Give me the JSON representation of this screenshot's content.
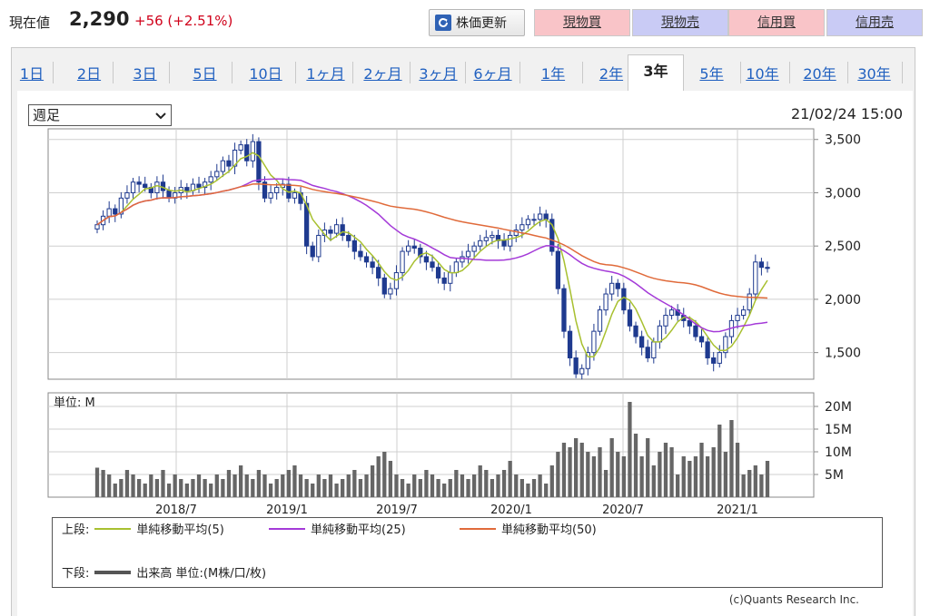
{
  "header": {
    "price_label": "現在値",
    "price_value": "2,290",
    "price_change": "+56 (+2.51%)",
    "refresh_label": "株価更新",
    "buttons": [
      {
        "label": "現物買",
        "kind": "buy"
      },
      {
        "label": "現物売",
        "kind": "sell"
      },
      {
        "label": "信用買",
        "kind": "buy"
      },
      {
        "label": "信用売",
        "kind": "sell"
      }
    ]
  },
  "tabs": [
    "1日",
    "2日",
    "3日",
    "5日",
    "10日",
    "1ヶ月",
    "2ヶ月",
    "3ヶ月",
    "6ヶ月",
    "1年",
    "2年",
    "3年",
    "5年",
    "10年",
    "20年",
    "30年"
  ],
  "active_tab": "3年",
  "period_select": "週足",
  "datetime": "21/02/24 15:00",
  "volume_unit_label": "単位: M",
  "legend": {
    "upper_label": "上段:",
    "lower_label": "下段:",
    "ma5": "単純移動平均(5)",
    "ma25": "単純移動平均(25)",
    "ma50": "単純移動平均(50)",
    "volume": "出来高 単位:(M株/口/枚)"
  },
  "copyright": "(c)Quants Research Inc.",
  "colors": {
    "up": "#ffffff",
    "down": "#1f3a8f",
    "ma5": "#a8c030",
    "ma25": "#a43ad8",
    "ma50": "#e06a3a",
    "volume": "#666666",
    "accent": "#2060c0"
  },
  "chart_data": {
    "type": "candlestick",
    "x_ticks": [
      "2018/7",
      "2019/1",
      "2019/7",
      "2020/1",
      "2020/7",
      "2021/1"
    ],
    "price_ticks": [
      "3,500",
      "3,000",
      "2,500",
      "2,000",
      "1,500"
    ],
    "price_tick_values": [
      3500,
      3000,
      2500,
      2000,
      1500
    ],
    "ylim": [
      1250,
      3600
    ],
    "volume_ticks": [
      "20M",
      "15M",
      "10M",
      "5M"
    ],
    "volume_tick_values": [
      20,
      15,
      10,
      5
    ],
    "volume_ylim": [
      0,
      23
    ],
    "weekly_close": [
      2700,
      2780,
      2850,
      2800,
      2950,
      3000,
      3100,
      3080,
      3050,
      3000,
      3100,
      3020,
      2950,
      3000,
      3050,
      3020,
      3080,
      3050,
      3100,
      3150,
      3200,
      3300,
      3250,
      3400,
      3450,
      3300,
      3480,
      3100,
      2950,
      3000,
      3050,
      3080,
      2950,
      3000,
      2900,
      2500,
      2400,
      2600,
      2650,
      2620,
      2700,
      2600,
      2550,
      2450,
      2400,
      2350,
      2300,
      2200,
      2050,
      2100,
      2250,
      2450,
      2500,
      2480,
      2400,
      2350,
      2300,
      2200,
      2150,
      2250,
      2350,
      2400,
      2450,
      2500,
      2550,
      2580,
      2600,
      2550,
      2500,
      2600,
      2650,
      2700,
      2750,
      2750,
      2800,
      2750,
      2450,
      2100,
      1700,
      1450,
      1300,
      1350,
      1500,
      1700,
      1900,
      2050,
      2150,
      2100,
      1900,
      1750,
      1650,
      1550,
      1450,
      1600,
      1750,
      1850,
      1900,
      1850,
      1800,
      1750,
      1650,
      1600,
      1450,
      1400,
      1500,
      1650,
      1800,
      1850,
      1900,
      2050,
      2350,
      2300,
      2290
    ],
    "volume": [
      6.5,
      6,
      5,
      3,
      4,
      6,
      5,
      4,
      3,
      5,
      4,
      6,
      3,
      5,
      4,
      3,
      4,
      5,
      4,
      3,
      5,
      4,
      6,
      5,
      7,
      5,
      4,
      6,
      5,
      3,
      4,
      5,
      6,
      7,
      5,
      4,
      3,
      5,
      4,
      5,
      3,
      4,
      5,
      6,
      4,
      5,
      7,
      9,
      10,
      8,
      5,
      4,
      3,
      5,
      4,
      6,
      5,
      4,
      3,
      4,
      6,
      5,
      4,
      5,
      7,
      6,
      4,
      5,
      6,
      8,
      5,
      4,
      3,
      4,
      5,
      3,
      7,
      10,
      12,
      11,
      13,
      12,
      10,
      9,
      11,
      6,
      13,
      10,
      9,
      21,
      14,
      9,
      13,
      7,
      10,
      12,
      11,
      5,
      9,
      8,
      9,
      12,
      9,
      11,
      16,
      10,
      17,
      12,
      5,
      6,
      7,
      5,
      8
    ]
  }
}
